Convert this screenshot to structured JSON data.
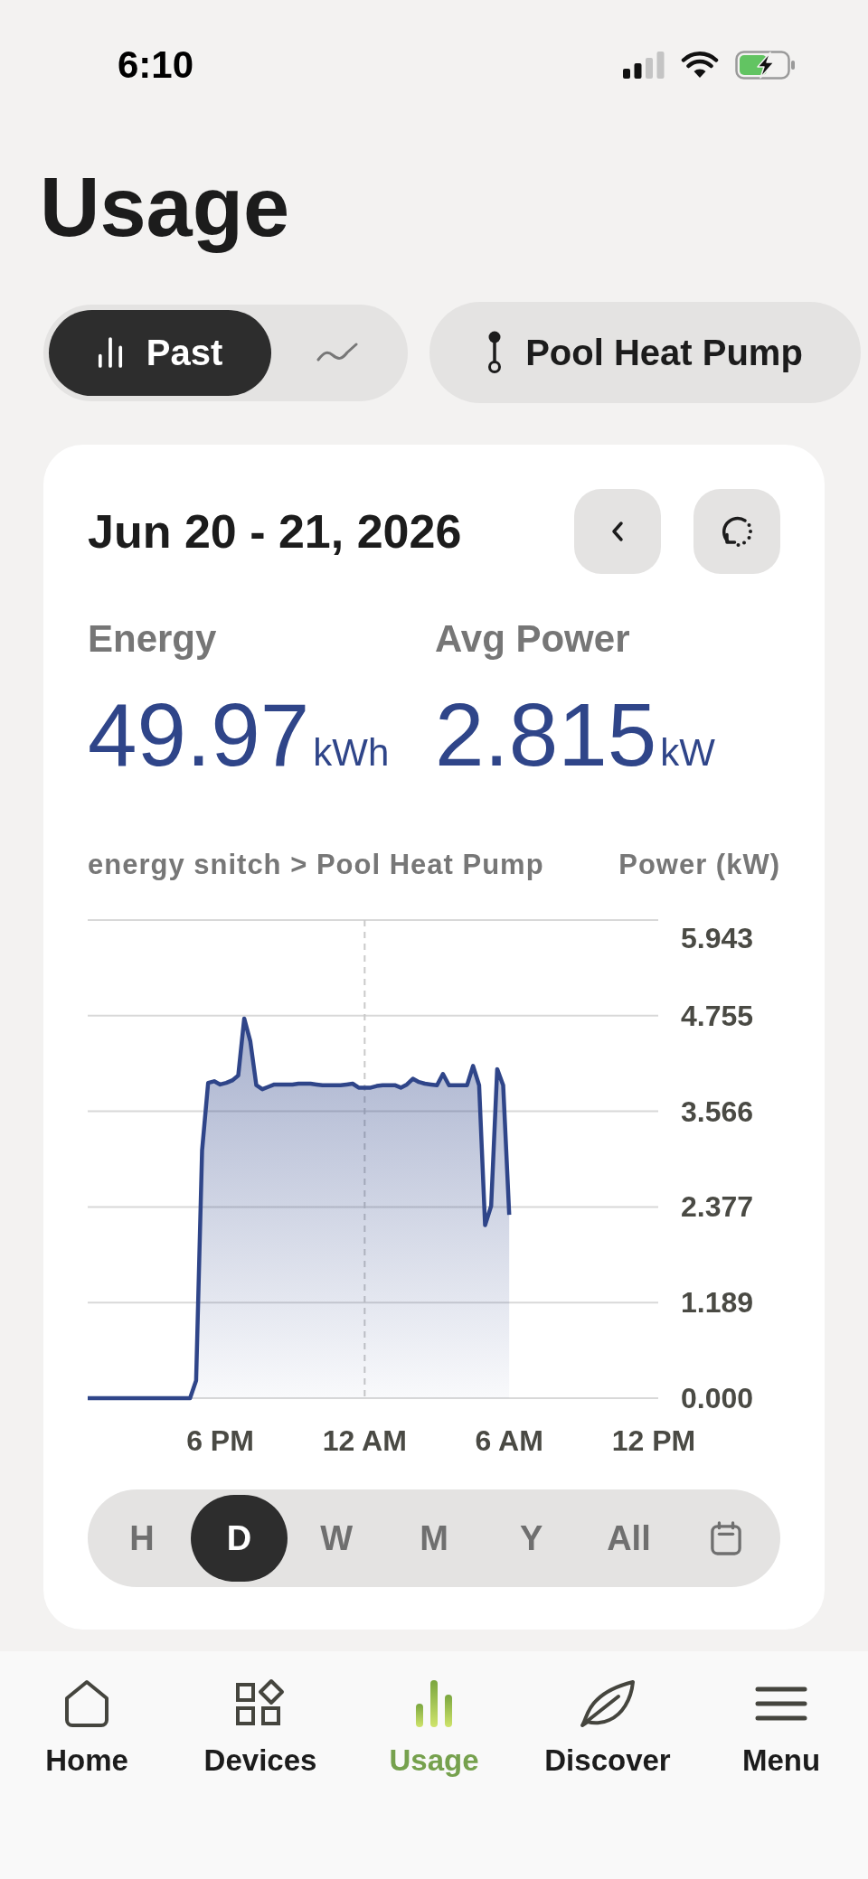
{
  "status_bar": {
    "time": "6:10"
  },
  "title": "Usage",
  "view_toggle": [
    {
      "kind": "bars",
      "label": "Past",
      "selected": true
    },
    {
      "kind": "trend",
      "selected": false
    }
  ],
  "device_picker": {
    "label": "Pool Heat Pump"
  },
  "card": {
    "date_range": "Jun 20 - 21, 2026",
    "stats": [
      {
        "label": "Energy",
        "value": "49.97",
        "unit": "kWh"
      },
      {
        "label": "Avg Power",
        "value": "2.815",
        "unit": "kW"
      }
    ],
    "chart_data": {
      "type": "area",
      "title": "energy snitch > Pool Heat Pump",
      "ylabel": "Power (kW)",
      "categories": [
        null,
        null,
        null,
        null,
        null,
        null,
        null,
        null,
        null,
        null,
        null,
        null,
        null,
        null,
        null,
        null,
        null,
        null,
        null,
        null,
        null,
        null,
        "6 PM",
        null,
        null,
        null,
        null,
        null,
        null,
        null,
        null,
        null,
        null,
        null,
        null,
        null,
        null,
        null,
        null,
        null,
        null,
        null,
        null,
        null,
        null,
        null,
        "12 AM",
        null,
        null,
        null,
        null,
        null,
        null,
        null,
        null,
        null,
        null,
        null,
        null,
        null,
        null,
        null,
        null,
        null,
        null,
        null,
        null,
        null,
        null,
        null,
        "6 AM",
        null,
        null,
        null,
        null,
        null,
        null,
        null,
        null,
        null,
        null,
        null,
        null,
        null,
        null,
        null,
        null,
        null,
        null,
        null,
        null,
        null,
        null,
        null,
        "12 PM"
      ],
      "series": [
        {
          "color": "#2f4589",
          "values": [
            0,
            0,
            0,
            0,
            0,
            0,
            0,
            0,
            0,
            0,
            0,
            0,
            0,
            0,
            0,
            0,
            0,
            0,
            0.22,
            3.08,
            3.92,
            3.94,
            3.9,
            3.92,
            3.95,
            4.01,
            4.72,
            4.44,
            3.89,
            3.84,
            3.87,
            3.9,
            3.9,
            3.9,
            3.9,
            3.91,
            3.91,
            3.91,
            3.9,
            3.89,
            3.89,
            3.89,
            3.89,
            3.9,
            3.91,
            3.86,
            3.86,
            3.86,
            3.88,
            3.89,
            3.89,
            3.89,
            3.86,
            3.9,
            3.97,
            3.93,
            3.91,
            3.9,
            3.89,
            4.03,
            3.89,
            3.89,
            3.89,
            3.89,
            4.13,
            3.89,
            2.15,
            2.39,
            4.09,
            3.89,
            2.28,
            null,
            null,
            null,
            null,
            null,
            null,
            null,
            null,
            null,
            null,
            null,
            null,
            null,
            null,
            null,
            null,
            null,
            null,
            null,
            null,
            null,
            null,
            null,
            null
          ]
        }
      ],
      "ylim": [
        0,
        5.943
      ],
      "yticks": [
        {
          "value": 0,
          "label": "0.000"
        },
        {
          "value": 1.189,
          "label": "1.189"
        },
        {
          "value": 2.377,
          "label": "2.377"
        },
        {
          "value": 3.566,
          "label": "3.566"
        },
        {
          "value": 4.755,
          "label": "4.755"
        },
        {
          "value": 5.943,
          "label": "5.943"
        }
      ],
      "grid": true,
      "ref_lines": [
        {
          "axis": "x",
          "value": "12 AM"
        }
      ]
    },
    "periods": [
      {
        "kind": "text",
        "label": "H",
        "selected": false
      },
      {
        "kind": "text",
        "label": "D",
        "selected": true
      },
      {
        "kind": "text",
        "label": "W",
        "selected": false
      },
      {
        "kind": "text",
        "label": "M",
        "selected": false
      },
      {
        "kind": "text",
        "label": "Y",
        "selected": false
      },
      {
        "kind": "text",
        "label": "All",
        "selected": false
      },
      {
        "kind": "calendar",
        "selected": false
      }
    ]
  },
  "bottom_nav": [
    {
      "kind": "home",
      "label": "Home",
      "selected": false
    },
    {
      "kind": "devices",
      "label": "Devices",
      "selected": false
    },
    {
      "kind": "usage",
      "label": "Usage",
      "selected": true
    },
    {
      "kind": "discover",
      "label": "Discover",
      "selected": false
    },
    {
      "kind": "menu",
      "label": "Menu",
      "selected": false
    }
  ]
}
